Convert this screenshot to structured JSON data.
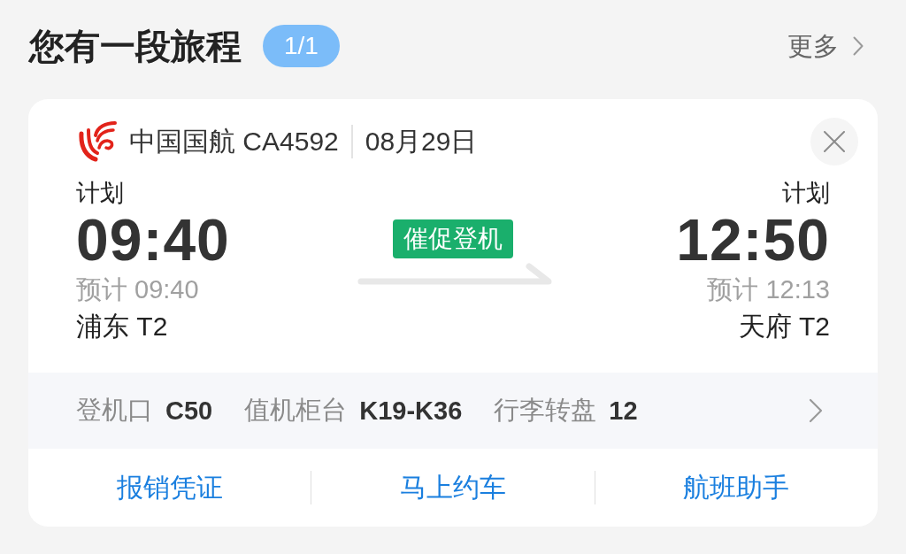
{
  "header": {
    "title": "您有一段旅程",
    "badge": "1/1",
    "more": "更多"
  },
  "flight": {
    "airline": "中国国航 CA4592",
    "date": "08月29日"
  },
  "departure": {
    "label": "计划",
    "time": "09:40",
    "estimate": "预计 09:40",
    "terminal": "浦东 T2"
  },
  "status": "催促登机",
  "arrival": {
    "label": "计划",
    "time": "12:50",
    "estimate": "预计 12:13",
    "terminal": "天府 T2"
  },
  "info": [
    {
      "label": "登机口",
      "value": "C50"
    },
    {
      "label": "值机柜台",
      "value": "K19-K36"
    },
    {
      "label": "行李转盘",
      "value": "12"
    }
  ],
  "actions": [
    "报销凭证",
    "马上约车",
    "航班助手"
  ]
}
